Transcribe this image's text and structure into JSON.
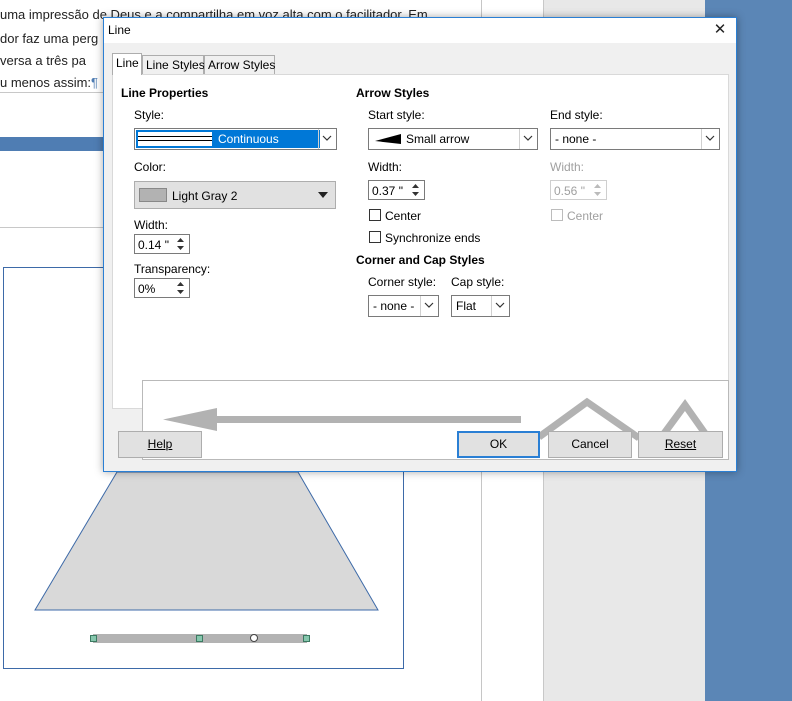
{
  "document": {
    "lines": [
      "uma impressão de Deus e a compartilha em voz alta com o facilitador. Em",
      "dor faz uma perg",
      "versa a três pa",
      "u menos assim:"
    ],
    "paragraph_mark": "¶"
  },
  "dialog": {
    "title": "Line",
    "close_glyph": "✕",
    "tabs": [
      {
        "label": "Line",
        "active": true
      },
      {
        "label": "Line Styles",
        "active": false
      },
      {
        "label": "Arrow Styles",
        "active": false
      }
    ],
    "line_properties": {
      "title": "Line Properties",
      "style_label": "Style:",
      "style_value": "Continuous",
      "color_label": "Color:",
      "color_value": "Light Gray 2",
      "color_swatch": "#b2b2b2",
      "width_label": "Width:",
      "width_value": "0.14 \"",
      "transparency_label": "Transparency:",
      "transparency_value": "0%"
    },
    "arrow_styles": {
      "title": "Arrow Styles",
      "start_style_label": "Start style:",
      "start_style_value": "Small arrow",
      "end_style_label": "End style:",
      "end_style_value": "- none -",
      "start_width_label": "Width:",
      "start_width_value": "0.37 \"",
      "end_width_label": "Width:",
      "end_width_value": "0.56 \"",
      "center_label": "Center",
      "end_center_label": "Center",
      "synchronize_label": "Synchronize ends"
    },
    "corner_cap": {
      "title": "Corner and Cap Styles",
      "corner_label": "Corner style:",
      "corner_value": "- none -",
      "cap_label": "Cap style:",
      "cap_value": "Flat"
    },
    "buttons": {
      "help": "Help",
      "ok": "OK",
      "cancel": "Cancel",
      "reset": "Reset"
    },
    "colors": {
      "accent": "#2a7fd4",
      "selection": "#0078d7",
      "preview_line": "#b2b2b2"
    }
  }
}
